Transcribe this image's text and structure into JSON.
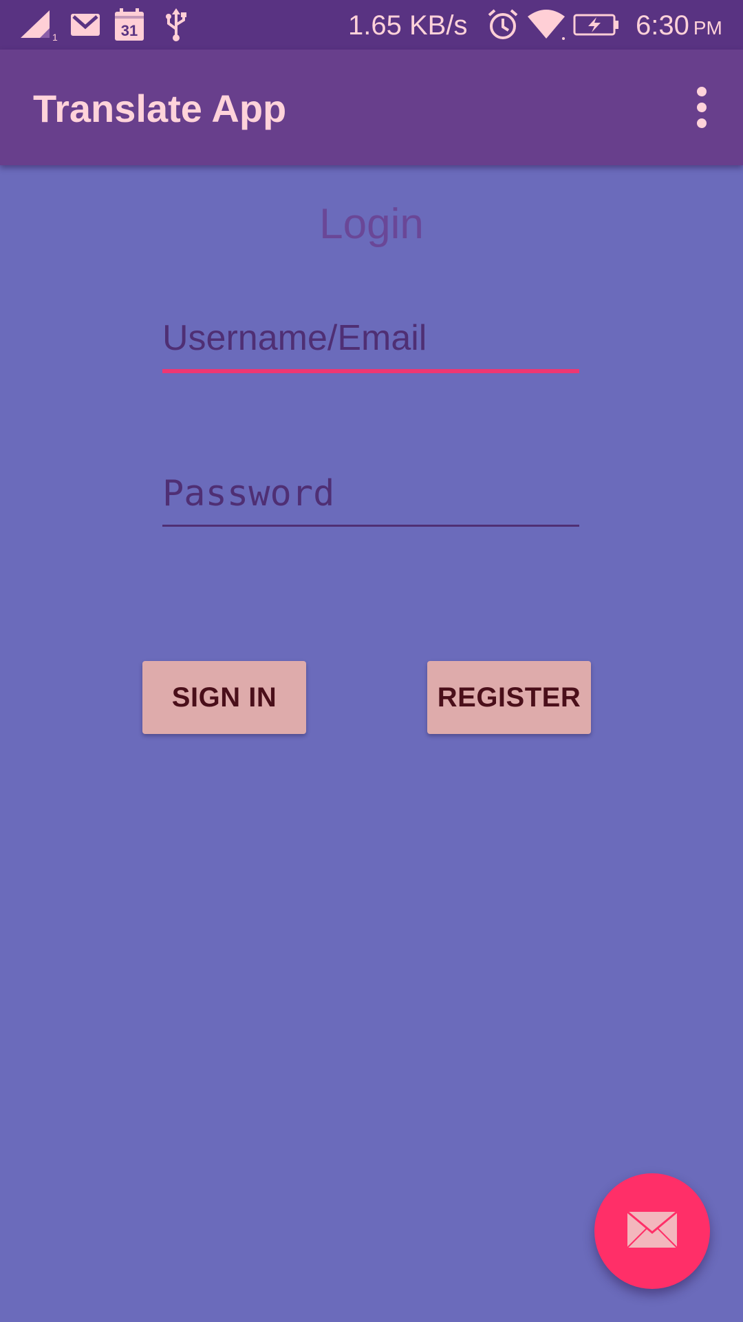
{
  "status_bar": {
    "network_speed": "1.65 KB/s",
    "time": "6:30",
    "ampm": "PM",
    "calendar_day": "31",
    "sim_slot": "1",
    "icons": [
      "signal-icon",
      "gmail-icon",
      "calendar-icon",
      "usb-icon",
      "alarm-icon",
      "wifi-icon",
      "battery-charging-icon"
    ]
  },
  "app_bar": {
    "title": "Translate App",
    "overflow_icon": "more-vert-icon"
  },
  "login": {
    "title": "Login",
    "username_placeholder": "Username/Email",
    "password_placeholder": "Password",
    "sign_in_label": "SIGN IN",
    "register_label": "REGISTER"
  },
  "fab": {
    "icon": "mail-icon"
  },
  "colors": {
    "status_bar": "#593382",
    "app_bar": "#683f8c",
    "background": "#6b6bbb",
    "accent": "#ee3773",
    "button": "#deabab",
    "fab": "#ff2f68",
    "text_light": "#ffd3da"
  }
}
